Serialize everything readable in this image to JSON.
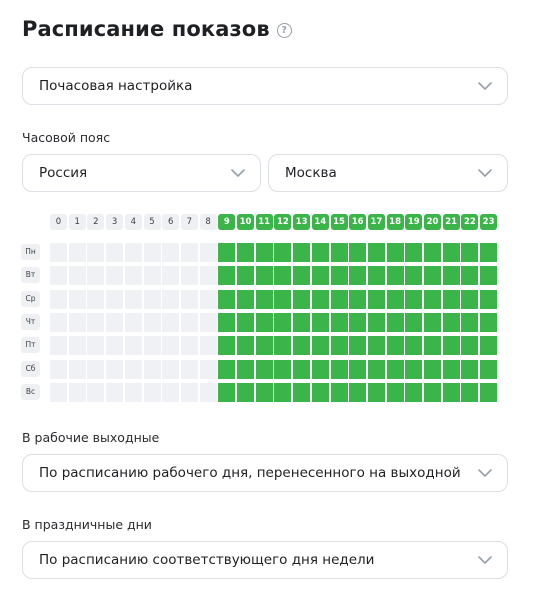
{
  "title": "Расписание показов",
  "help_icon": "?",
  "schedule_mode": {
    "value": "Почасовая настройка"
  },
  "timezone": {
    "label": "Часовой пояс",
    "country": "Россия",
    "city": "Москва"
  },
  "hours": [
    "0",
    "1",
    "2",
    "3",
    "4",
    "5",
    "6",
    "7",
    "8",
    "9",
    "10",
    "11",
    "12",
    "13",
    "14",
    "15",
    "16",
    "17",
    "18",
    "19",
    "20",
    "21",
    "22",
    "23"
  ],
  "days": [
    "Пн",
    "Вт",
    "Ср",
    "Чт",
    "Пт",
    "Сб",
    "Вс"
  ],
  "active_hours_from": 9,
  "active_hours_to": 23,
  "colors": {
    "active": "#3bb54a",
    "inactive": "#eff1f4",
    "border": "#dcdfe3"
  },
  "working_weekends": {
    "label": "В рабочие выходные",
    "value": "По расписанию рабочего дня, перенесенного на выходной"
  },
  "holidays": {
    "label": "В праздничные дни",
    "value": "По расписанию соответствующего дня недели"
  }
}
